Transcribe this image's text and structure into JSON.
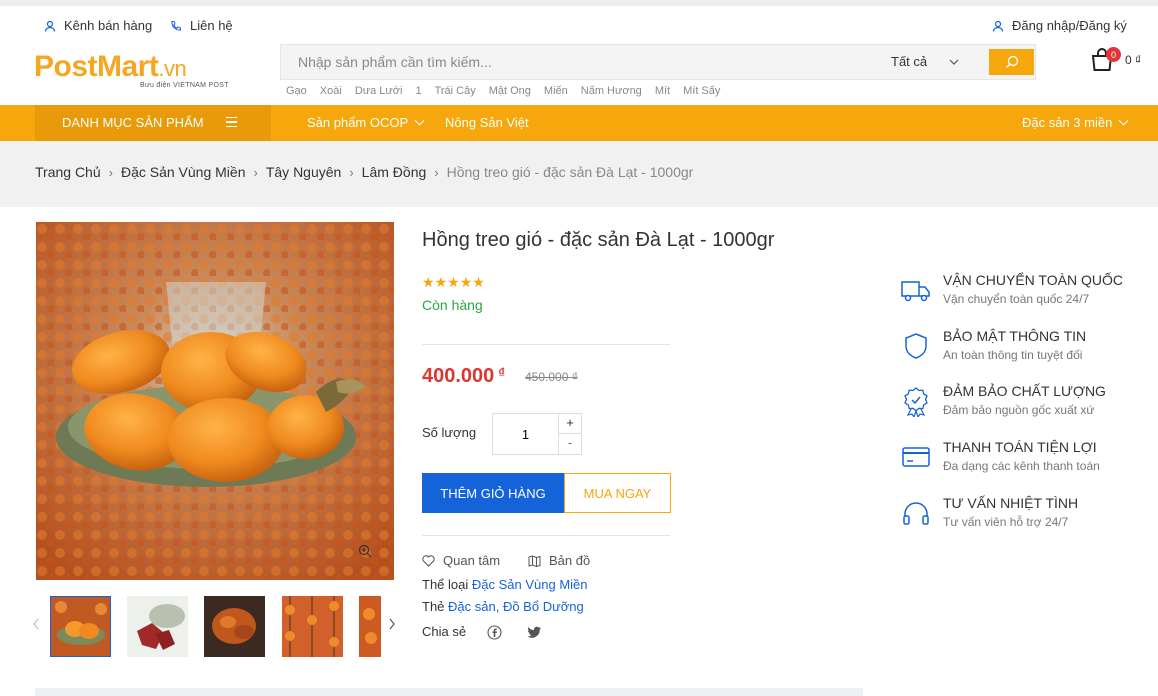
{
  "topbar": {
    "seller_channel": "Kênh bán hàng",
    "contact": "Liên hệ",
    "login": "Đăng nhập/Đăng ký"
  },
  "header": {
    "logo_main": "PostMart",
    "logo_tld": ".vn",
    "logo_sub": "Bưu điện VIETNAM POST",
    "search_placeholder": "Nhập sản phẩm cần tìm kiếm...",
    "search_category": "Tất cả",
    "tags": [
      "Gạo",
      "Xoài",
      "Dưa Lưới",
      "1",
      "Trái Cây",
      "Mật Ong",
      "Miến",
      "Nấm Hương",
      "Mít",
      "Mít Sấy"
    ],
    "cart_count": "0",
    "cart_total": "0 ₫"
  },
  "nav": {
    "category_menu": "DANH MỤC SẢN PHẨM",
    "ocop": "Sản phẩm OCOP",
    "agri": "Nông Sản Việt",
    "regional": "Đặc sản 3 miền"
  },
  "breadcrumb": {
    "items": [
      "Trang Chủ",
      "Đặc Sản Vùng Miền",
      "Tây Nguyên",
      "Lâm Đồng"
    ],
    "current": "Hồng treo gió - đặc sản Đà Lạt - 1000gr"
  },
  "product": {
    "title": "Hồng treo gió - đặc sản Đà Lạt - 1000gr",
    "rating": 5,
    "rating_max": 5,
    "stock": "Còn hàng",
    "price": "400.000",
    "currency": "₫",
    "old_price": "450.000 ₫",
    "qty_label": "Số lượng",
    "qty": "1",
    "add_to_cart": "THÊM GIỎ HÀNG",
    "buy_now": "MUA NGAY",
    "wishlist": "Quan tâm",
    "map": "Bản đồ",
    "category_label": "Thể loại",
    "category_value": "Đặc Sản Vùng Miền",
    "tag_label": "Thẻ",
    "tag_value": "Đặc sản, Đồ Bổ Dưỡng",
    "share_label": "Chia sẻ"
  },
  "services": [
    {
      "title": "VẬN CHUYỂN TOÀN QUỐC",
      "sub": "Vận chuyển toàn quốc 24/7",
      "icon": "truck-icon"
    },
    {
      "title": "BẢO MẬT THÔNG TIN",
      "sub": "An toàn thông tin tuyệt đối",
      "icon": "shield-icon"
    },
    {
      "title": "ĐẢM BẢO CHẤT LƯỢNG",
      "sub": "Đảm bảo nguồn gốc xuất xứ",
      "icon": "award-icon"
    },
    {
      "title": "THANH TOÁN TIỆN LỢI",
      "sub": "Đa dạng các kênh thanh toán",
      "icon": "credit-card-icon"
    },
    {
      "title": "TƯ VẤN NHIỆT TÌNH",
      "sub": "Tư vấn viên hỗ trợ 24/7",
      "icon": "headphones-icon"
    }
  ],
  "colors": {
    "brand_orange": "#f5a70c",
    "primary_blue": "#1463d8",
    "price_red": "#d9382f",
    "stock_green": "#27a844"
  }
}
